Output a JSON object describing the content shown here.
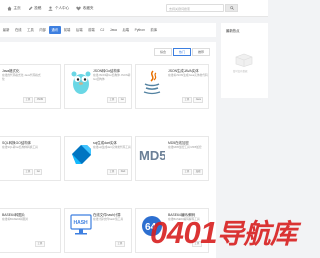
{
  "topbar": {
    "links": [
      {
        "label": "主页",
        "icon": "home-icon"
      },
      {
        "label": "投稿",
        "icon": "edit-icon"
      },
      {
        "label": "个人中心",
        "icon": "user-icon"
      },
      {
        "label": "收藏夹",
        "icon": "heart-icon"
      }
    ],
    "search_placeholder": "支持关键词搜索",
    "search_icon": "search-icon"
  },
  "categories": [
    "最新",
    "在线",
    "工具",
    "内部",
    "通讯",
    "前端",
    "后端",
    "前端",
    "CJ",
    "Java",
    "后端",
    "Python",
    "前库"
  ],
  "active_category": 4,
  "sort": {
    "options": [
      "综合",
      "热门",
      "推荐"
    ],
    "active": 1
  },
  "cards": [
    {
      "title": "Java格式化",
      "desc": "在线的代码格式化 Java代码格式化",
      "tags": [
        "工具",
        "JSON"
      ]
    },
    {
      "title": "JSON转Go结构体",
      "desc": "在线JSON转Go结构体 JSON转Go结构体",
      "tags": [
        "工具",
        "Go"
      ]
    },
    {
      "title": "JSON生成JAVA实体",
      "desc": "在线将JSON生成Java实体类代码",
      "tags": [
        "工具",
        "Java"
      ]
    },
    {
      "title": "SQL转换GO结构体",
      "desc": "在线SQL转Go结构体转换工具",
      "tags": [
        "工具",
        "Go"
      ]
    },
    {
      "title": "sql生成dart实体",
      "desc": "在线sql生成dart实体类代码工具",
      "tags": [
        "工具",
        "Dart"
      ]
    },
    {
      "title": "MD5在线加密",
      "desc": "在线MD5加密工具 MD5加密",
      "tags": [
        "工具",
        "加密"
      ]
    },
    {
      "title": "BASE64转图片",
      "desc": "在线将BASE64转图片",
      "tags": [
        "工具"
      ]
    },
    {
      "title": "在线文件hash计算",
      "desc": "在线计算文件hash值工具",
      "tags": [
        "工具"
      ]
    },
    {
      "title": "BASE64编码/解码",
      "desc": "在线BASE64编码解码工具",
      "tags": [
        "工具"
      ]
    }
  ],
  "sidebar": {
    "title": "最新热点",
    "empty_text": "暂时没有数据"
  },
  "watermark": {
    "code": "0401",
    "text": "导航库"
  },
  "colors": {
    "accent": "#3d7fe0",
    "watermark": "#d71e1e"
  }
}
